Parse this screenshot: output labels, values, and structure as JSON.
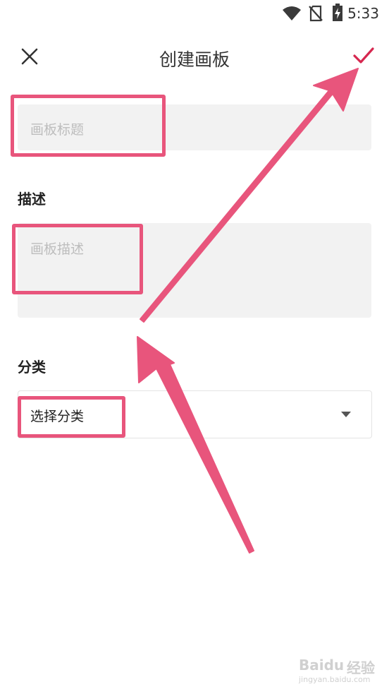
{
  "status_bar": {
    "time": "5:33"
  },
  "header": {
    "title": "创建画板"
  },
  "form": {
    "title_placeholder": "画板标题",
    "description_label": "描述",
    "description_placeholder": "画板描述",
    "category_label": "分类",
    "category_selected": "选择分类"
  },
  "watermark": {
    "brand": "Baidu",
    "brand_suffix": "经验",
    "url": "jingyan.baidu.com"
  },
  "colors": {
    "accent": "#d6274f",
    "annotation": "#e8557c",
    "field_bg": "#f2f2f2"
  },
  "icons": [
    "wifi-icon",
    "no-sim-icon",
    "battery-charging-icon",
    "close-icon",
    "check-icon",
    "dropdown-arrow-icon"
  ]
}
